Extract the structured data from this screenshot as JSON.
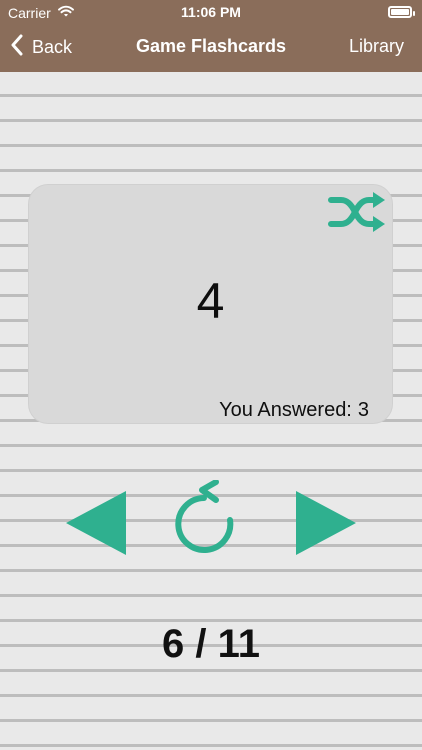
{
  "status": {
    "carrier": "Carrier",
    "time": "11:06 PM"
  },
  "nav": {
    "back_label": "Back",
    "title": "Game Flashcards",
    "library_label": "Library"
  },
  "card": {
    "value": "4",
    "answered_label": "You Answered:",
    "answered_value": "3"
  },
  "progress": {
    "current": "6",
    "total": "11"
  },
  "icons": {
    "shuffle": "shuffle-icon",
    "prev": "triangle-left-icon",
    "refresh": "refresh-icon",
    "next": "triangle-right-icon",
    "back": "chevron-left-icon",
    "wifi": "wifi-icon",
    "battery": "battery-icon"
  },
  "colors": {
    "header": "#8a6d5a",
    "accent": "#2fb08f",
    "card": "#d9d9d9",
    "line": "#bdbdbd",
    "background": "#e9e9e9"
  }
}
